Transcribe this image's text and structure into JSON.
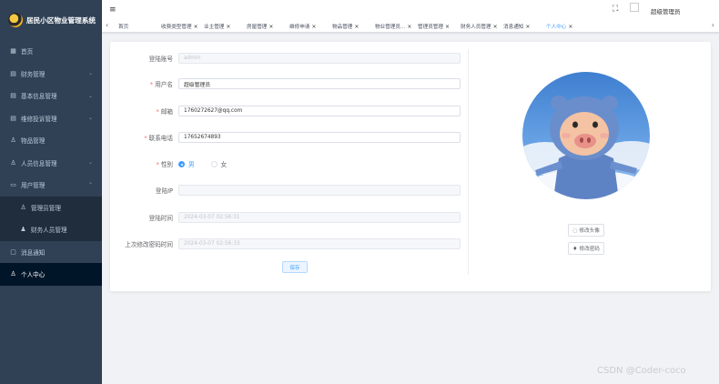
{
  "sidebar": {
    "title": "居民小区物业管理系统",
    "items": [
      {
        "label": "首页",
        "icon": "dashboard-icon"
      },
      {
        "label": "财务管理",
        "icon": "document-icon",
        "chevron": "⌄"
      },
      {
        "label": "基本信息管理",
        "icon": "document-icon",
        "chevron": "⌄"
      },
      {
        "label": "维修投诉管理",
        "icon": "document-icon",
        "chevron": "⌄"
      },
      {
        "label": "物品管理",
        "icon": "user-icon"
      },
      {
        "label": "人员信息管理",
        "icon": "user-icon",
        "chevron": "⌄"
      },
      {
        "label": "用户管理",
        "icon": "folder-icon",
        "chevron": "⌃"
      },
      {
        "label": "管理员管理",
        "icon": "user-icon"
      },
      {
        "label": "财务人员管理",
        "icon": "user-icon"
      },
      {
        "label": "消息通知",
        "icon": "message-icon"
      },
      {
        "label": "个人中心",
        "icon": "user-icon"
      }
    ]
  },
  "header": {
    "menu_glyph": "≡",
    "fullscreen_glyph": "⛶",
    "user_name": "超级管理员"
  },
  "tabs": {
    "left_arrow": "‹",
    "right_arrow": "›",
    "items": [
      {
        "label": "首页"
      },
      {
        "label": "收费类型管理"
      },
      {
        "label": "业主管理"
      },
      {
        "label": "房屋管理"
      },
      {
        "label": "维修申请"
      },
      {
        "label": "物品管理"
      },
      {
        "label": "物业管理员..."
      },
      {
        "label": "管理员管理"
      },
      {
        "label": "财务人员管理"
      },
      {
        "label": "消息通知"
      },
      {
        "label": "个人中心"
      }
    ],
    "close_glyph": "×"
  },
  "form": {
    "fields": [
      {
        "label": "登陆账号",
        "required": false,
        "value": "admin",
        "disabled": true
      },
      {
        "label": "用户名",
        "required": true,
        "value": "超级管理员",
        "disabled": false
      },
      {
        "label": "邮箱",
        "required": true,
        "value": "1760272627@qq.com",
        "disabled": false
      },
      {
        "label": "联系电话",
        "required": true,
        "value": "17652674893",
        "disabled": false
      },
      {
        "label": "登陆IP",
        "required": false,
        "value": "",
        "disabled": true
      },
      {
        "label": "登陆时间",
        "required": false,
        "value": "2024-03-07 02:56:31",
        "disabled": true
      },
      {
        "label": "上次修改密码时间",
        "required": false,
        "value": "2024-03-07 02:56:33",
        "disabled": true
      }
    ],
    "gender": {
      "label": "性别",
      "required": true,
      "options": [
        "男",
        "女"
      ],
      "selected": "男"
    },
    "required_mark": "*",
    "save_label": "保存"
  },
  "side": {
    "change_avatar": "修改头像",
    "change_password": "修改密码"
  },
  "watermark": "CSDN @Coder-coco",
  "colors": {
    "sidebar_bg": "#304156",
    "sidebar_active": "#001528",
    "primary": "#409eff",
    "required": "#f56c6c"
  }
}
